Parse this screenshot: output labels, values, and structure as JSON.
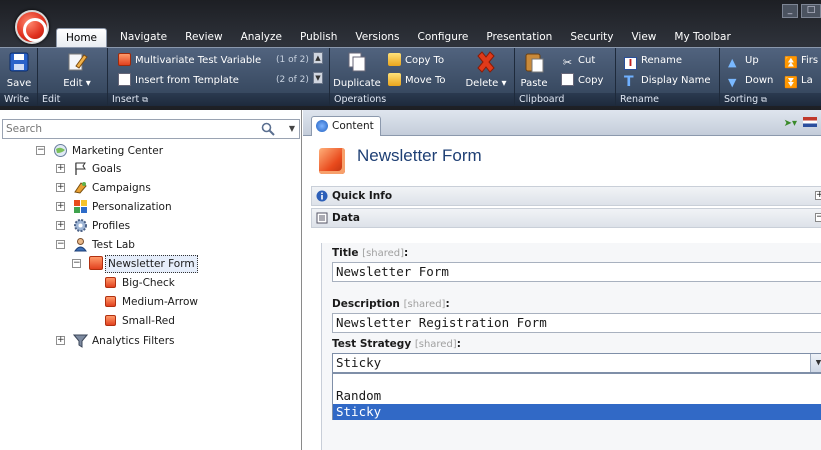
{
  "tabs": [
    "Home",
    "Navigate",
    "Review",
    "Analyze",
    "Publish",
    "Versions",
    "Configure",
    "Presentation",
    "Security",
    "View",
    "My Toolbar"
  ],
  "groups": {
    "write": {
      "label": "Write",
      "save": "Save"
    },
    "edit": {
      "label": "Edit",
      "edit": "Edit"
    },
    "insert": {
      "label": "Insert",
      "item1": "Multivariate Test Variable",
      "item1_page": "(1 of 2)",
      "item2": "Insert from Template",
      "item2_page": "(2 of 2)"
    },
    "operations": {
      "label": "Operations",
      "duplicate": "Duplicate",
      "copy_to": "Copy To",
      "move_to": "Move To",
      "delete": "Delete"
    },
    "clipboard": {
      "label": "Clipboard",
      "paste": "Paste",
      "cut": "Cut",
      "copy": "Copy"
    },
    "rename": {
      "label": "Rename",
      "rename": "Rename",
      "display_name": "Display Name"
    },
    "sorting": {
      "label": "Sorting",
      "up": "Up",
      "down": "Down",
      "first": "Firs",
      "last": "La"
    }
  },
  "search": {
    "placeholder": "Search"
  },
  "tree": {
    "root": "Marketing Center",
    "goals": "Goals",
    "campaigns": "Campaigns",
    "personalization": "Personalization",
    "profiles": "Profiles",
    "test_lab": "Test Lab",
    "newsletter_form": "Newsletter Form",
    "big_check": "Big-Check",
    "medium_arrow": "Medium-Arrow",
    "small_red": "Small-Red",
    "analytics_filters": "Analytics Filters"
  },
  "content": {
    "tab_label": "Content",
    "item_title": "Newsletter Form",
    "sections": {
      "quick_info": "Quick Info",
      "data": "Data"
    },
    "fields": {
      "title_label": "Title",
      "title_value": "Newsletter Form",
      "description_label": "Description",
      "description_value": "Newsletter Registration Form",
      "strategy_label": "Test Strategy",
      "strategy_value": "Sticky",
      "shared_tag": "[shared]",
      "colon": ":"
    },
    "strategy_options": [
      "Random",
      "Sticky"
    ],
    "strategy_selected": "Sticky"
  },
  "colors": {
    "ribbon": "#2e323a",
    "toolbar": "#41536d",
    "selection": "#3169c6",
    "title": "#1e3f74"
  }
}
